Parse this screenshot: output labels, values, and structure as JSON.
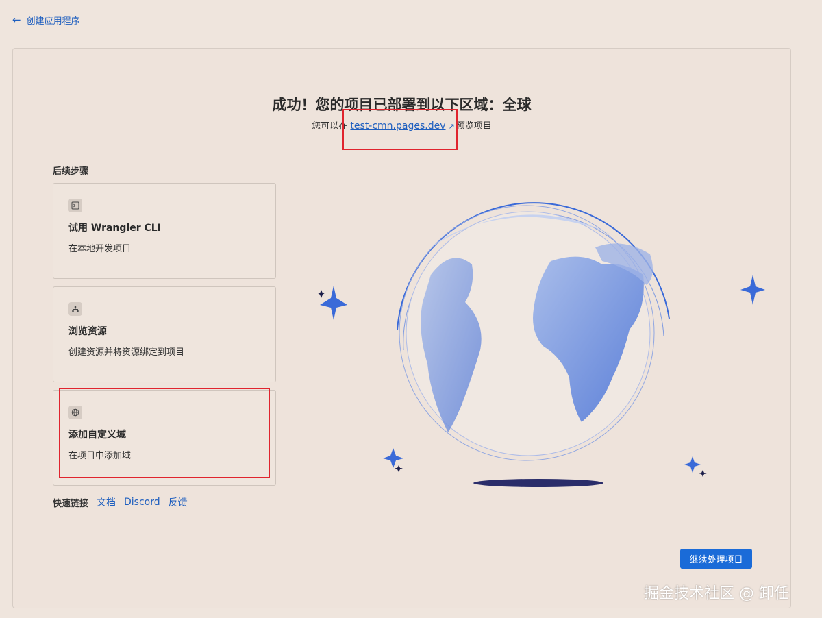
{
  "nav": {
    "back_label": "创建应用程序"
  },
  "header": {
    "title": "成功！您的项目已部署到以下区域：全球",
    "subtitle_prefix": "您可以在",
    "preview_link": "test-cmn.pages.dev",
    "subtitle_suffix": "预览项目"
  },
  "next_steps": {
    "label": "后续步骤",
    "items": [
      {
        "title": "试用 Wrangler CLI",
        "desc": "在本地开发项目",
        "icon": "terminal-icon"
      },
      {
        "title": "浏览资源",
        "desc": "创建资源并将资源绑定到项目",
        "icon": "bindings-icon"
      },
      {
        "title": "添加自定义域",
        "desc": "在项目中添加域",
        "icon": "globe-icon"
      }
    ]
  },
  "quick_links": {
    "label": "快速链接",
    "items": [
      "文档",
      "Discord",
      "反馈"
    ]
  },
  "continue_button": "继续处理项目",
  "watermark": "掘金技术社区 @ 卸任",
  "colors": {
    "accent": "#1a6bd8",
    "link": "#1f5fbf",
    "highlight_border": "#e0242e",
    "background": "#efe5dd"
  }
}
